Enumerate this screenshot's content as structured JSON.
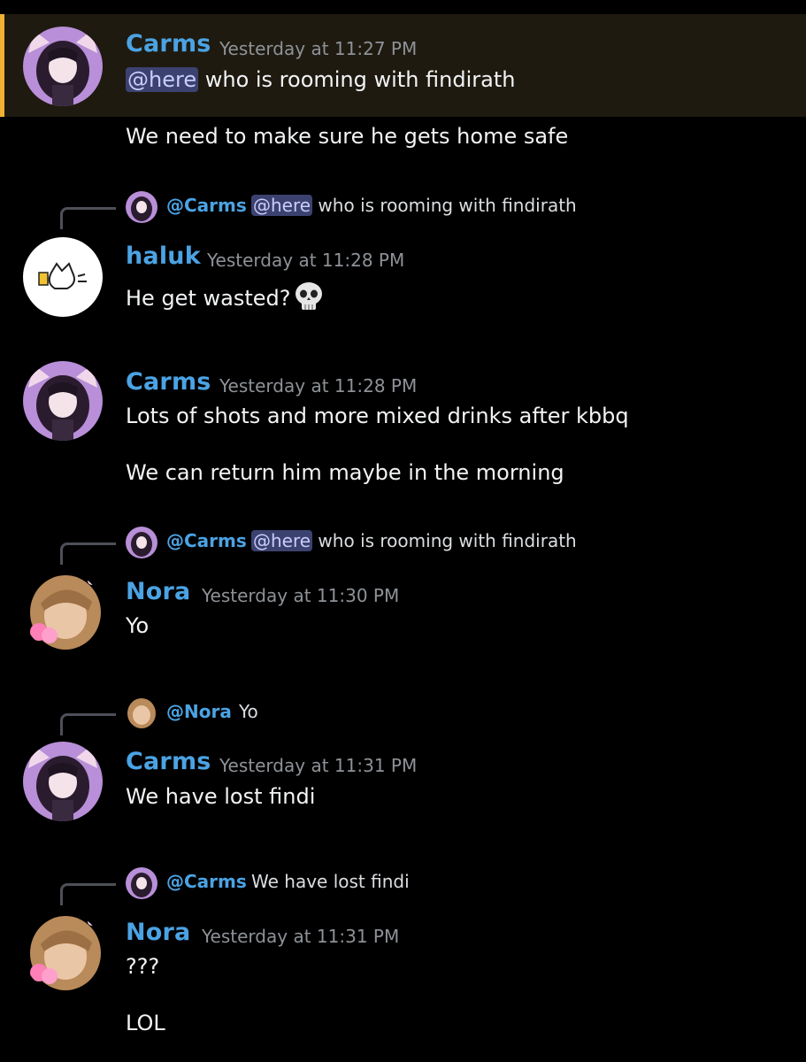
{
  "messages": [
    {
      "author": "Carms",
      "time": "Yesterday at 11:27 PM",
      "mention": "@here",
      "text": " who is rooming with findirath",
      "text2": "We need to make sure he gets home safe"
    },
    {
      "reply": {
        "name": "@Carms",
        "mention": "@here",
        "text": " who is rooming with findirath"
      },
      "author": "haluk",
      "time": "Yesterday at 11:28 PM",
      "text": "He get wasted?",
      "emoji": "skull-emoji"
    },
    {
      "author": "Carms",
      "time": "Yesterday at 11:28 PM",
      "text": "Lots of shots and more mixed drinks after kbbq",
      "text2": "We can return him maybe in the morning"
    },
    {
      "reply": {
        "name": "@Carms",
        "mention": "@here",
        "text": " who is rooming with findirath"
      },
      "author": "Nora",
      "time": "Yesterday at 11:30 PM",
      "text": "Yo"
    },
    {
      "reply": {
        "name": "@Nora",
        "text": "Yo"
      },
      "author": "Carms",
      "time": "Yesterday at 11:31 PM",
      "text": "We have lost findi"
    },
    {
      "reply": {
        "name": "@Carms",
        "text": "We have lost findi"
      },
      "author": "Nora",
      "time": "Yesterday at 11:31 PM",
      "text": "???",
      "text2": "LOL"
    }
  ],
  "colors": {
    "background": "#000000",
    "username": "#4ba3e3",
    "mention_bg": "#3c4270",
    "highlight_bar": "#f0b232",
    "timestamp": "#8e9297"
  }
}
